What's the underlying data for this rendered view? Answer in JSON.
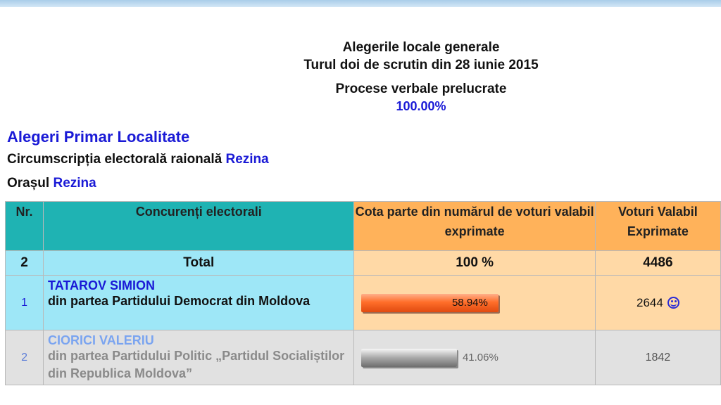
{
  "header": {
    "title": "Alegerile locale generale",
    "subtitle": "Turul doi de scrutin din 28 iunie 2015",
    "processed_label": "Procese verbale prelucrate",
    "processed_percent": "100.00%"
  },
  "section": {
    "title": "Alegeri Primar Localitate",
    "circ_label": "Circumscripția electorală raională",
    "circ_value": "Rezina",
    "oras_label": "Orașul",
    "oras_value": "Rezina"
  },
  "table": {
    "headers": {
      "nr": "Nr.",
      "candidates": "Concurenți electorali",
      "share": "Cota parte din numărul de voturi valabil exprimate",
      "votes": "Voturi Valabil Exprimate"
    },
    "total": {
      "nr": "2",
      "label": "Total",
      "share": "100 %",
      "votes": "4486"
    },
    "rows": [
      {
        "nr": "1",
        "name": "TATAROV SIMION",
        "party": "din partea Partidului Democrat din Moldova",
        "percent_label": "58.94%",
        "percent": 58.94,
        "votes": "2644",
        "winner_icon": "smiley-icon",
        "bar_color": "#ff6e2a"
      },
      {
        "nr": "2",
        "name": "CIORICI VALERIU",
        "party": "din partea Partidului Politic „Partidul Socialiștilor din Republica Moldova”",
        "percent_label": "41.06%",
        "percent": 41.06,
        "votes": "1842",
        "bar_color": "#a8a8a8"
      }
    ]
  },
  "colors": {
    "accent_blue": "#1a1ad6",
    "header_teal": "#1fb3b3",
    "header_orange": "#ffb25a",
    "row_lightblue": "#9ee7f7",
    "row_peach": "#ffd9a6",
    "row_gray": "#e1e1e1"
  }
}
